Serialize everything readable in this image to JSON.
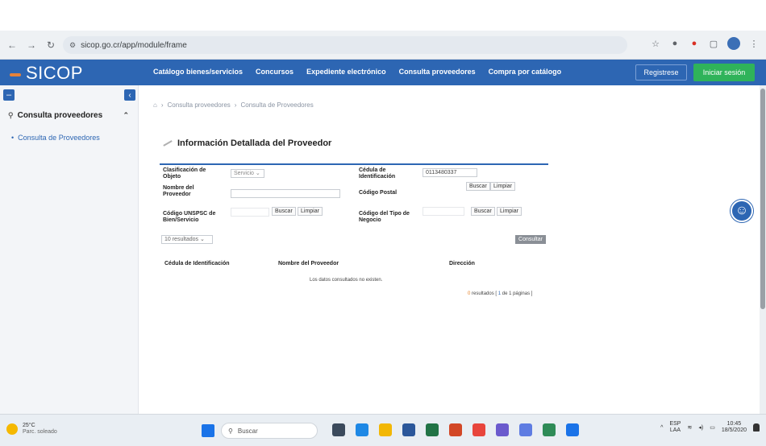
{
  "browser": {
    "url": "sicop.go.cr/app/module/frame",
    "back_icon": "arrow-left-icon",
    "forward_icon": "arrow-right-icon",
    "reload_icon": "reload-icon"
  },
  "app": {
    "logo": "SICOP",
    "nav": [
      "Catálogo bienes/servicios",
      "Concursos",
      "Expediente electrónico",
      "Consulta proveedores",
      "Compra por catálogo"
    ],
    "register": "Registrese",
    "login": "Iniciar sesión",
    "brand_color": "#2d66b3",
    "login_color": "#2fb35a"
  },
  "sidebar": {
    "section": "Consulta proveedores",
    "item": "Consulta de Proveedores"
  },
  "breadcrumb": [
    "Consulta proveedores",
    "Consulta de Proveedores"
  ],
  "page_title": "Información Detallada del Proveedor",
  "form": {
    "clasificacion_label": "Clasificación de Objeto",
    "clasificacion_value": "Servicio",
    "cedula_label": "Cédula de Identificación",
    "cedula_value": "0113480337",
    "nombre_label": "Nombre del Proveedor",
    "postal_label": "Código Postal",
    "unspsc_label": "Código UNSPSC de Bien/Servicio",
    "tipo_label": "Código del Tipo de Negocio",
    "buscar": "Buscar",
    "limpiar": "Limpiar",
    "resultados_select": "10 resultados",
    "consultar": "Consultar"
  },
  "table": {
    "headers": [
      "Cédula de Identificación",
      "Nombre del Proveedor",
      "Dirección"
    ],
    "empty": "Los datos consultados no existen.",
    "pager_count": "0",
    "pager_text": "resultados [",
    "pager_page": "1",
    "pager_rest": "de 1 páginas ]"
  },
  "taskbar": {
    "temp": "25°C",
    "weather": "Parc. soleado",
    "search": "Buscar",
    "lang1": "ESP",
    "lang2": "LAA",
    "time": "10:45",
    "date": "18/5/2020"
  }
}
